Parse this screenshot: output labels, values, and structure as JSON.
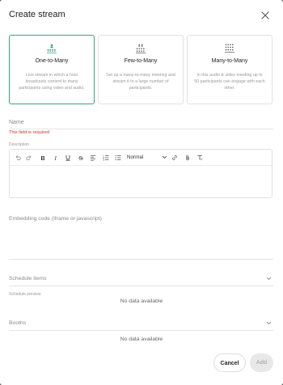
{
  "dialog": {
    "title": "Create stream"
  },
  "stream_types": [
    {
      "name": "One-to-Many",
      "description": "Live stream in which a host broadcasts content to many participants using video and audio.",
      "selected": true
    },
    {
      "name": "Few-to-Many",
      "description": "Set up a many-to-many meeting and stream it to a large number of participants.",
      "selected": false
    },
    {
      "name": "Many-to-Many",
      "description": "In this audio & video meeting up to 50 participants can engage with each other.",
      "selected": false
    }
  ],
  "form": {
    "name_placeholder": "Name",
    "name_error": "This field is required",
    "description_label": "Description",
    "format_selected": "Normal",
    "embed_placeholder": "Embedding code (iframe or javascript)",
    "schedule_items_placeholder": "Schedule items",
    "schedule_preview_label": "Schedule preview",
    "schedule_preview_empty": "No data available",
    "booths_placeholder": "Booths",
    "booths_empty": "No data available"
  },
  "actions": {
    "cancel_label": "Cancel",
    "add_label": "Add"
  },
  "colors": {
    "accent": "#34a481",
    "error": "#c0392b",
    "overlay": "#5f5f5f",
    "disabled_bg": "#e8e8e8"
  },
  "icons": {
    "close": "close-icon",
    "one_to_many": "one-to-many-icon",
    "few_to_many": "few-to-many-icon",
    "many_to_many": "many-to-many-icon",
    "undo": "undo-icon",
    "redo": "redo-icon",
    "bold": "bold-icon",
    "italic": "italic-icon",
    "underline": "underline-icon",
    "strikethrough": "strikethrough-icon",
    "align": "align-left-icon",
    "ordered_list": "ordered-list-icon",
    "bullet_list": "bullet-list-icon",
    "link": "link-icon",
    "attachment": "attachment-icon",
    "clear_format": "clear-format-icon",
    "chevron": "chevron-down-icon"
  }
}
